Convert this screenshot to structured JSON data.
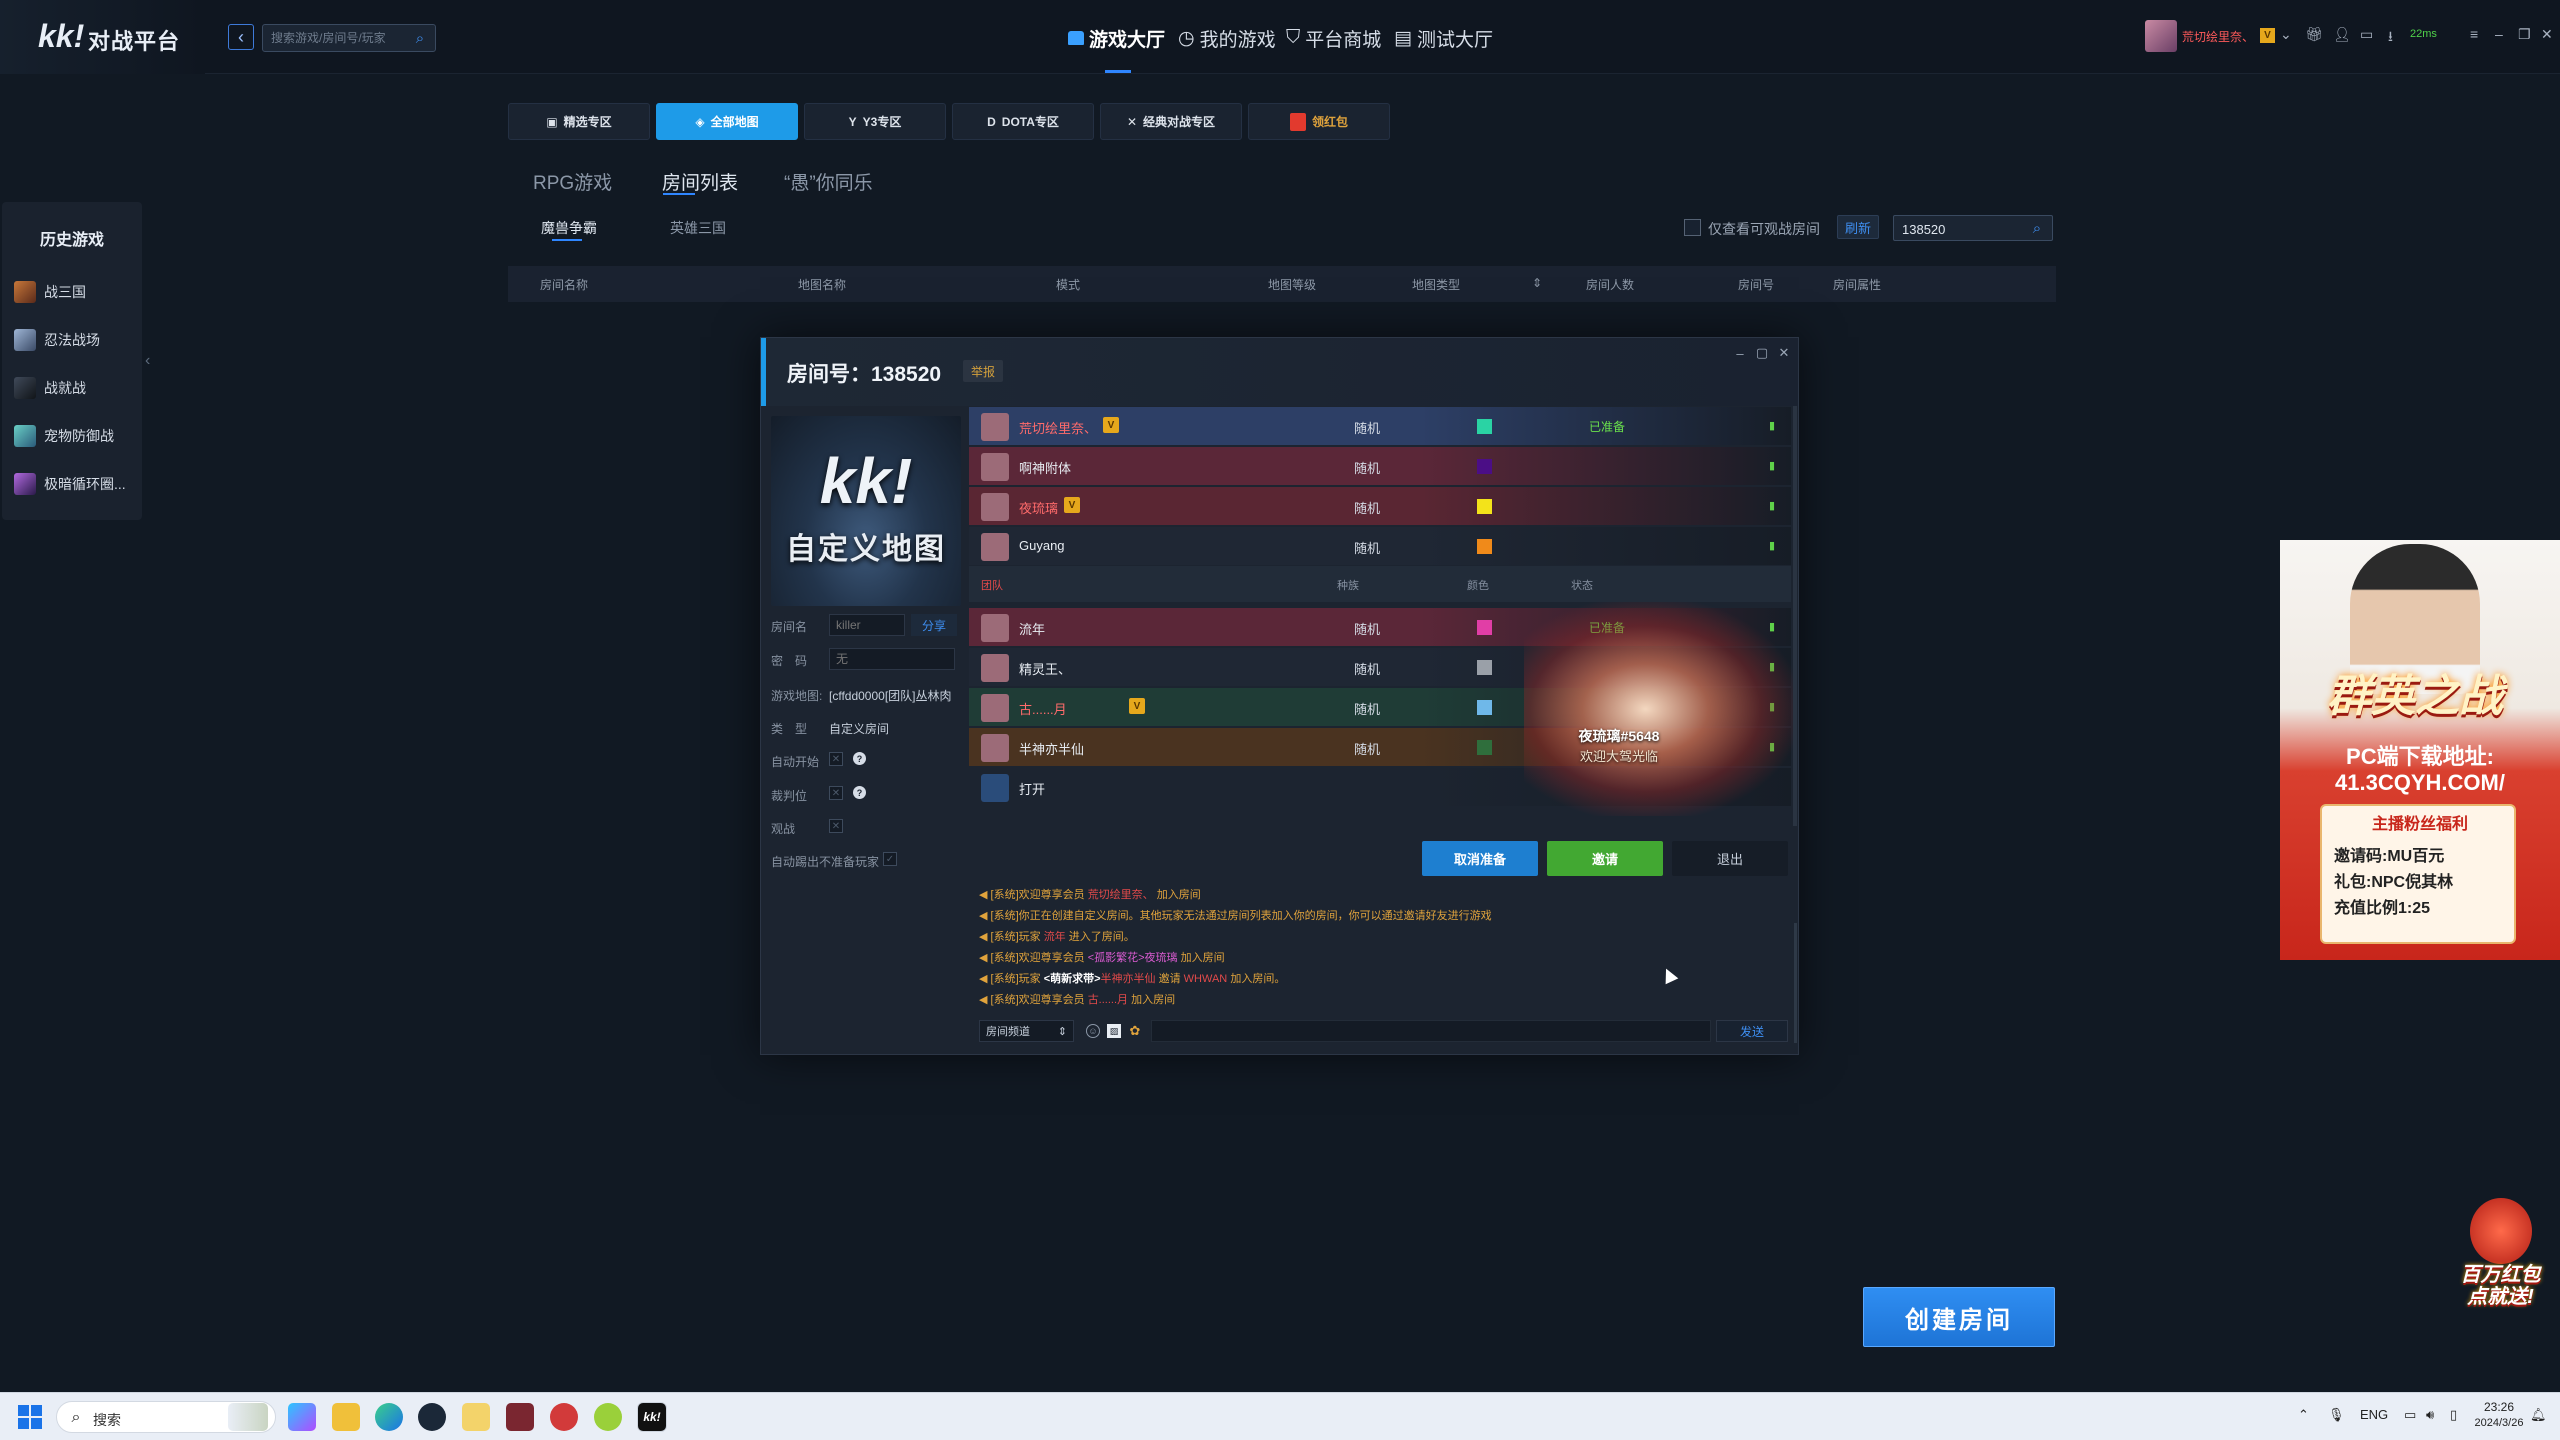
{
  "app": {
    "logo_mark": "kk!",
    "logo_text": "对战平台"
  },
  "search": {
    "placeholder": "搜索游戏/房间号/玩家"
  },
  "nav": [
    {
      "label": "游戏大厅",
      "icon": "home-icon",
      "active": true
    },
    {
      "label": "我的游戏",
      "icon": "clock-icon"
    },
    {
      "label": "平台商城",
      "icon": "cart-icon"
    },
    {
      "label": "测试大厅",
      "icon": "test-icon"
    }
  ],
  "user": {
    "name": "荒切绘里奈、",
    "vip": "V",
    "ping": "22ms"
  },
  "categories": [
    "精选专区",
    "全部地图",
    "Y3专区",
    "DOTA专区",
    "经典对战专区",
    "领红包"
  ],
  "subtabs": [
    "RPG游戏",
    "房间列表",
    "“愚”你同乐"
  ],
  "subsubtabs": [
    "魔兽争霸",
    "英雄三国"
  ],
  "filter": {
    "label": "仅查看可观战房间",
    "refresh": "刷新",
    "room_query": "138520"
  },
  "table_headers": [
    "房间名称",
    "地图名称",
    "模式",
    "地图等级",
    "地图类型",
    "房间人数",
    "房间号",
    "房间属性"
  ],
  "history": {
    "title": "历史游戏",
    "items": [
      "战三国",
      "忍法战场",
      "战就战",
      "宠物防御战",
      "极暗循环圈..."
    ]
  },
  "room": {
    "title": "房间号：138520",
    "report": "举报",
    "map_kk": "kk!",
    "map_caption": "自定义地图",
    "fields": {
      "room_name_label": "房间名",
      "room_name_placeholder": "killer",
      "share": "分享",
      "password_label": "密　码",
      "password_placeholder": "无",
      "map_label": "游戏地图:",
      "map_value": "[cffdd0000[团队]丛林肉",
      "type_label": "类　型",
      "type_value": "自定义房间",
      "autostart_label": "自动开始",
      "referee_label": "裁判位",
      "watch_label": "观战",
      "kick_label": "自动踢出不准备玩家"
    },
    "team_header": {
      "team": "团队",
      "race": "种族",
      "color": "颜色",
      "status": "状态"
    },
    "players_top": [
      {
        "name": "荒切绘里奈、",
        "vip": "V",
        "race": "随机",
        "color": "#2ad3a4",
        "status": "已准备",
        "name_color": "#ff6b6b",
        "bg": "#2d3f66"
      },
      {
        "name": "啊神附体",
        "vip": "",
        "race": "随机",
        "color": "#4b0e86",
        "status": "",
        "name_color": "#e7ecf2",
        "bg": "#5b2738"
      },
      {
        "name": "夜琉璃",
        "vip": "V",
        "race": "随机",
        "color": "#f3e31a",
        "status": "",
        "name_color": "#ff6b6b",
        "bg": "#5a2633"
      },
      {
        "name": "Guyang",
        "vip": "",
        "race": "随机",
        "color": "#f08a1a",
        "status": "",
        "name_color": "#e7ecf2",
        "bg": "#1f2734"
      }
    ],
    "players_bottom": [
      {
        "name": "流年",
        "vip": "",
        "race": "随机",
        "color": "#e13ea6",
        "status": "已准备",
        "name_color": "#e7ecf2",
        "bg": "#5b2738"
      },
      {
        "name": "精灵王、",
        "vip": "",
        "race": "随机",
        "color": "#9aa0a8",
        "status": "",
        "name_color": "#e7ecf2",
        "bg": "#1f2734"
      },
      {
        "name": "古......月",
        "vip": "V",
        "race": "随机",
        "color": "#6fb8e9",
        "status": "",
        "name_color": "#ff6b6b",
        "bg": "#1f3c36"
      },
      {
        "name": "半神亦半仙",
        "vip": "",
        "race": "随机",
        "color": "#2f6e3c",
        "status": "",
        "name_color": "#e7ecf2",
        "bg": "#4a3320"
      },
      {
        "name": "打开",
        "vip": "",
        "race": "",
        "color": "",
        "status": "",
        "name_color": "#e7ecf2",
        "bg": "#1c2430"
      }
    ],
    "portrait": {
      "name": "夜琉璃#5648",
      "welcome": "欢迎大驾光临"
    },
    "buttons": {
      "cancel": "取消准备",
      "invite": "邀请",
      "exit": "退出"
    },
    "chat": [
      {
        "prefix": "[系统]欢迎尊享会员 ",
        "hl": "荒切绘里奈、",
        "suffix": " 加入房间"
      },
      {
        "prefix": "[系统]你正在创建自定义房间。其他玩家无法通过房间列表加入你的房间，你可以通过邀请好友进行游戏",
        "hl": "",
        "suffix": ""
      },
      {
        "prefix": "[系统]玩家 ",
        "hl": "流年",
        "suffix": " 进入了房间。"
      },
      {
        "prefix": "[系统]欢迎尊享会员 ",
        "hl": "<孤影繁花>夜琉璃",
        "suffix": " 加入房间"
      },
      {
        "prefix": "[系统]玩家 ",
        "hl": "<萌新求带>",
        "hl2": "半神亦半仙",
        "mid": " 邀请 ",
        "hl3": "WHWAN",
        "suffix": " 加入房间。"
      },
      {
        "prefix": "[系统]欢迎尊享会员 ",
        "hl": "古......月",
        "suffix": " 加入房间"
      }
    ],
    "channel": "房间频道",
    "send": "发送"
  },
  "ad": {
    "title": "群英之战",
    "download": "PC端下载地址:",
    "url": "41.3CQYH.COM/",
    "box_title": "主播粉丝福利",
    "lines": [
      "邀请码:MU百元",
      "礼包:NPC倪其林",
      "充值比例1:25"
    ]
  },
  "redpack": {
    "line1": "百万红包",
    "line2": "点就送!"
  },
  "create_room": "创建房间",
  "taskbar": {
    "search": "搜索",
    "lang": "ENG",
    "time": "23:26",
    "date": "2024/3/26"
  },
  "colors": {
    "accent": "#1e9be8",
    "primary_btn": "#1e7fd0",
    "invite_btn": "#42a832",
    "bg": "#111923"
  }
}
